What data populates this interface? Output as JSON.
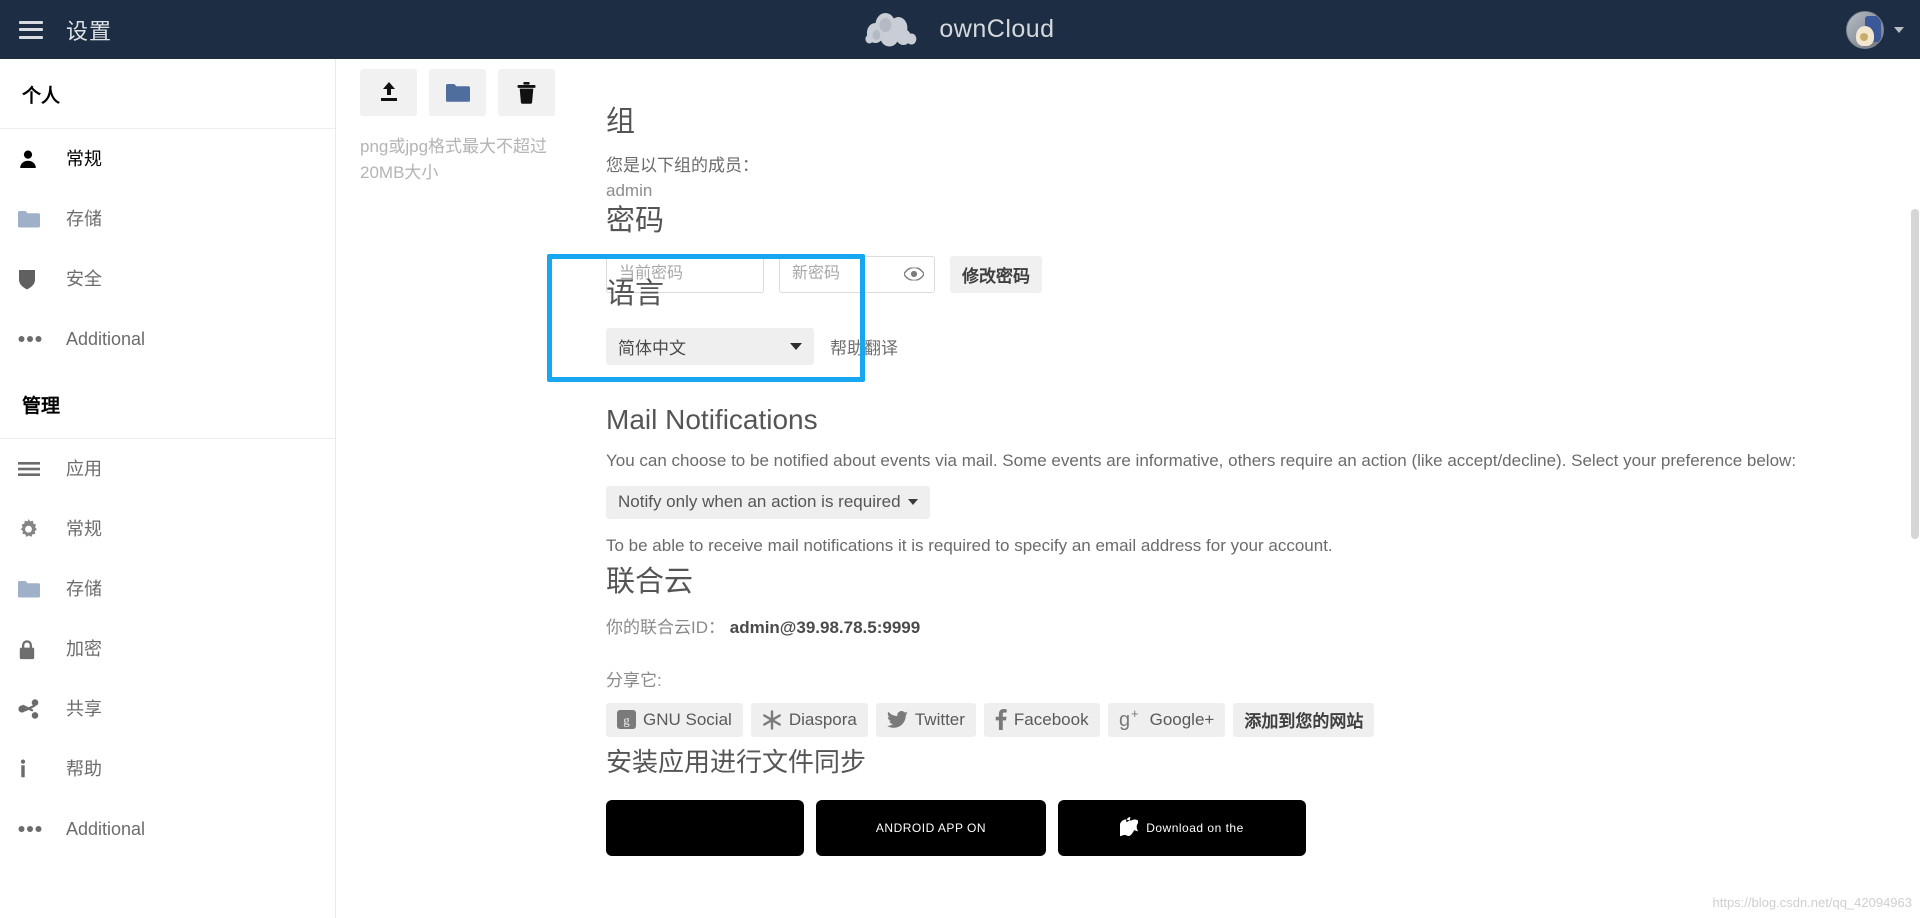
{
  "header": {
    "menu_icon": "hamburger-icon",
    "title": "设置",
    "logo_text": "ownCloud",
    "avatar_icon": "user-avatar",
    "caret_icon": "chevron-down-icon"
  },
  "sidebar": {
    "personal_group": "个人",
    "admin_group": "管理",
    "personal_items": [
      {
        "icon": "user-icon",
        "label": "常规",
        "active": true
      },
      {
        "icon": "folder-icon",
        "label": "存储",
        "active": false
      },
      {
        "icon": "shield-icon",
        "label": "安全",
        "active": false
      },
      {
        "icon": "ellipsis-icon",
        "label": "Additional",
        "active": false
      }
    ],
    "admin_items": [
      {
        "icon": "list-icon",
        "label": "应用",
        "active": false
      },
      {
        "icon": "gear-icon",
        "label": "常规",
        "active": false
      },
      {
        "icon": "folder-icon",
        "label": "存储",
        "active": false
      },
      {
        "icon": "lock-icon",
        "label": "加密",
        "active": false
      },
      {
        "icon": "share-icon",
        "label": "共享",
        "active": false
      },
      {
        "icon": "info-icon",
        "label": "帮助",
        "active": false
      },
      {
        "icon": "ellipsis-icon",
        "label": "Additional",
        "active": false
      }
    ]
  },
  "avatar_upload": {
    "upload_icon": "upload-icon",
    "folder_icon": "folder-icon",
    "delete_icon": "trash-icon",
    "hint": "png或jpg格式最大不超过20MB大小"
  },
  "groups": {
    "heading": "组",
    "member_text": "您是以下组的成员：",
    "group_name": "admin"
  },
  "password": {
    "heading": "密码",
    "current_placeholder": "当前密码",
    "current_value": "",
    "new_placeholder": "新密码",
    "new_value": "",
    "eye_icon": "eye-icon",
    "change_button": "修改密码"
  },
  "language": {
    "heading": "语言",
    "selected": "简体中文",
    "dropdown_icon": "caret-down-icon",
    "help_translate_link": "帮助翻译",
    "highlight_color": "#16A7F0"
  },
  "mail_notifications": {
    "heading": "Mail Notifications",
    "description": "You can choose to be notified about events via mail. Some events are informative, others require an action (like accept/decline). Select your preference below:",
    "selected_option": "Notify only when an action is required",
    "dropdown_icon": "caret-down-icon",
    "note": "To be able to receive mail notifications it is required to specify an email address for your account."
  },
  "federated_cloud": {
    "heading": "联合云",
    "id_label": "你的联合云ID：",
    "id_value": "admin@39.98.78.5:9999",
    "share_label": "分享它:",
    "social_buttons": [
      {
        "icon": "gnusocial-icon",
        "label": "GNU Social"
      },
      {
        "icon": "diaspora-icon",
        "label": "Diaspora"
      },
      {
        "icon": "twitter-icon",
        "label": "Twitter"
      },
      {
        "icon": "facebook-icon",
        "label": "Facebook"
      },
      {
        "icon": "googleplus-icon",
        "label": "Google+"
      }
    ],
    "add_to_site_button": "添加到您的网站"
  },
  "install_apps": {
    "heading": "安装应用进行文件同步",
    "badges": [
      {
        "sub": "",
        "main": ""
      },
      {
        "sub": "ANDROID APP ON",
        "main": ""
      },
      {
        "sub": "Download on the",
        "main": ""
      }
    ]
  },
  "watermark": "https://blog.csdn.net/qq_42094963"
}
